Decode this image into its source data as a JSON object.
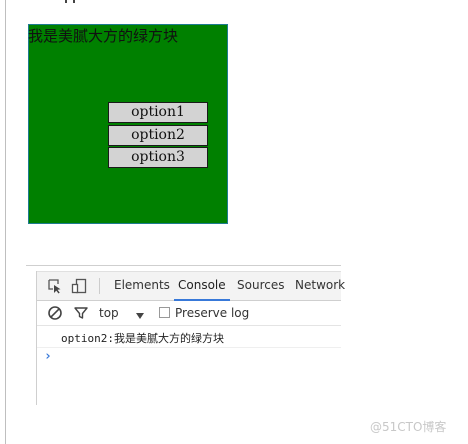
{
  "page": {
    "green_box": {
      "title": "我是美腻大方的绿方块",
      "background": "#008000",
      "options": [
        {
          "label": "option1"
        },
        {
          "label": "option2"
        },
        {
          "label": "option3"
        }
      ]
    },
    "devtools": {
      "tabs": [
        {
          "label": "Elements"
        },
        {
          "label": "Console",
          "active": true
        },
        {
          "label": "Sources"
        },
        {
          "label": "Network"
        }
      ],
      "toolbar": {
        "context": "top",
        "preserve_log_label": "Preserve log",
        "preserve_log_checked": false
      },
      "console": {
        "message": "option2:我是美腻大方的绿方块",
        "prompt": "›"
      },
      "accent": "#3879d9"
    },
    "watermark": "@51CTO博客",
    "icons": [
      "inspect-element-icon",
      "device-toolbar-icon",
      "clear-console-icon",
      "filter-icon",
      "dropdown-arrow-icon"
    ]
  }
}
